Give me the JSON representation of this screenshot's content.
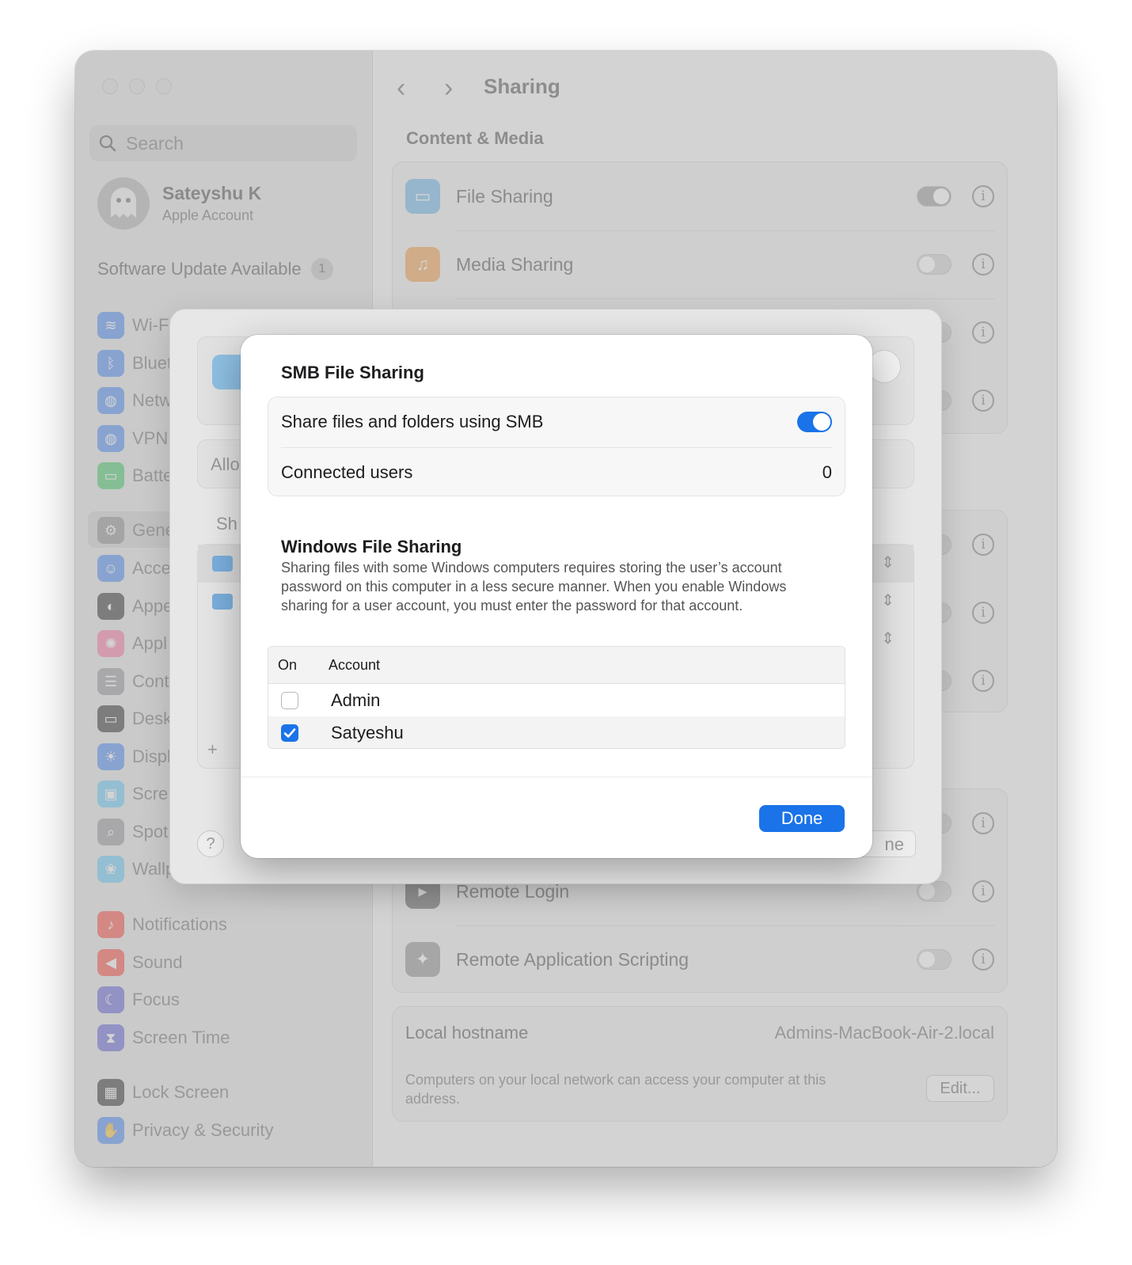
{
  "sidebar": {
    "search_placeholder": "Search",
    "account_name": "Sateyshu K",
    "account_sub": "Apple Account",
    "update_label": "Software Update Available",
    "update_count": "1",
    "items": [
      {
        "label": "Wi-F",
        "icon": "wifi-icon",
        "color": "#3b82f6"
      },
      {
        "label": "Bluet",
        "icon": "bluetooth-icon",
        "color": "#3b82f6"
      },
      {
        "label": "Netw",
        "icon": "globe-icon",
        "color": "#3b82f6"
      },
      {
        "label": "VPN",
        "icon": "vpn-globe-icon",
        "color": "#3b82f6"
      },
      {
        "label": "Batte",
        "icon": "battery-icon",
        "color": "#34c759"
      },
      {
        "label": "Gene",
        "icon": "gear-icon",
        "color": "#8e8e93"
      },
      {
        "label": "Acce",
        "icon": "accessibility-icon",
        "color": "#3b82f6"
      },
      {
        "label": "Appe",
        "icon": "appearance-icon",
        "color": "#1d1d1f"
      },
      {
        "label": "Appl",
        "icon": "apple-intelligence-icon",
        "color": "#ff6b9d"
      },
      {
        "label": "Cont",
        "icon": "control-center-icon",
        "color": "#8e8e93"
      },
      {
        "label": "Desk",
        "icon": "desktop-dock-icon",
        "color": "#1d1d1f"
      },
      {
        "label": "Displ",
        "icon": "sun-icon",
        "color": "#3b82f6"
      },
      {
        "label": "Scre",
        "icon": "screen-saver-icon",
        "color": "#5ac8fa"
      },
      {
        "label": "Spot",
        "icon": "magnifier-icon",
        "color": "#8e8e93"
      },
      {
        "label": "Wallp",
        "icon": "flower-icon",
        "color": "#5ac8fa"
      },
      {
        "label": "Notifications",
        "icon": "bell-icon",
        "color": "#ff3b30"
      },
      {
        "label": "Sound",
        "icon": "speaker-icon",
        "color": "#ff3b30"
      },
      {
        "label": "Focus",
        "icon": "moon-icon",
        "color": "#5856d6"
      },
      {
        "label": "Screen Time",
        "icon": "hourglass-icon",
        "color": "#5856d6"
      },
      {
        "label": "Lock Screen",
        "icon": "lock-icon",
        "color": "#1d1d1f"
      },
      {
        "label": "Privacy & Security",
        "icon": "hand-icon",
        "color": "#3b82f6"
      }
    ]
  },
  "main": {
    "title": "Sharing",
    "section": "Content & Media",
    "rows": [
      {
        "label": "File Sharing",
        "on": true
      },
      {
        "label": "Media Sharing",
        "on": false
      },
      {
        "label": "Remote Login",
        "on": false
      },
      {
        "label": "Remote Application Scripting",
        "on": false
      }
    ],
    "hostname_label": "Local hostname",
    "hostname_value": "Admins-MacBook-Air-2.local",
    "hostname_desc": "Computers on your local network can access your computer at this address.",
    "edit_button": "Edit..."
  },
  "underlay": {
    "allow_text": "Allo",
    "shared_text": "Sh",
    "plus": "+",
    "help": "?",
    "done_partial": "ne"
  },
  "sheet": {
    "title": "SMB File Sharing",
    "share_label": "Share files and folders using SMB",
    "share_on": true,
    "connected_label": "Connected users",
    "connected_value": "0",
    "windows_title": "Windows File Sharing",
    "windows_desc": "Sharing files with some Windows computers requires storing the user’s account password on this computer in a less secure manner. When you enable Windows sharing for a user account, you must enter the password for that account.",
    "col_on": "On",
    "col_account": "Account",
    "accounts": [
      {
        "name": "Admin",
        "checked": false
      },
      {
        "name": "Satyeshu",
        "checked": true
      }
    ],
    "done_label": "Done"
  },
  "colors": {
    "accent": "#1a73e8"
  }
}
